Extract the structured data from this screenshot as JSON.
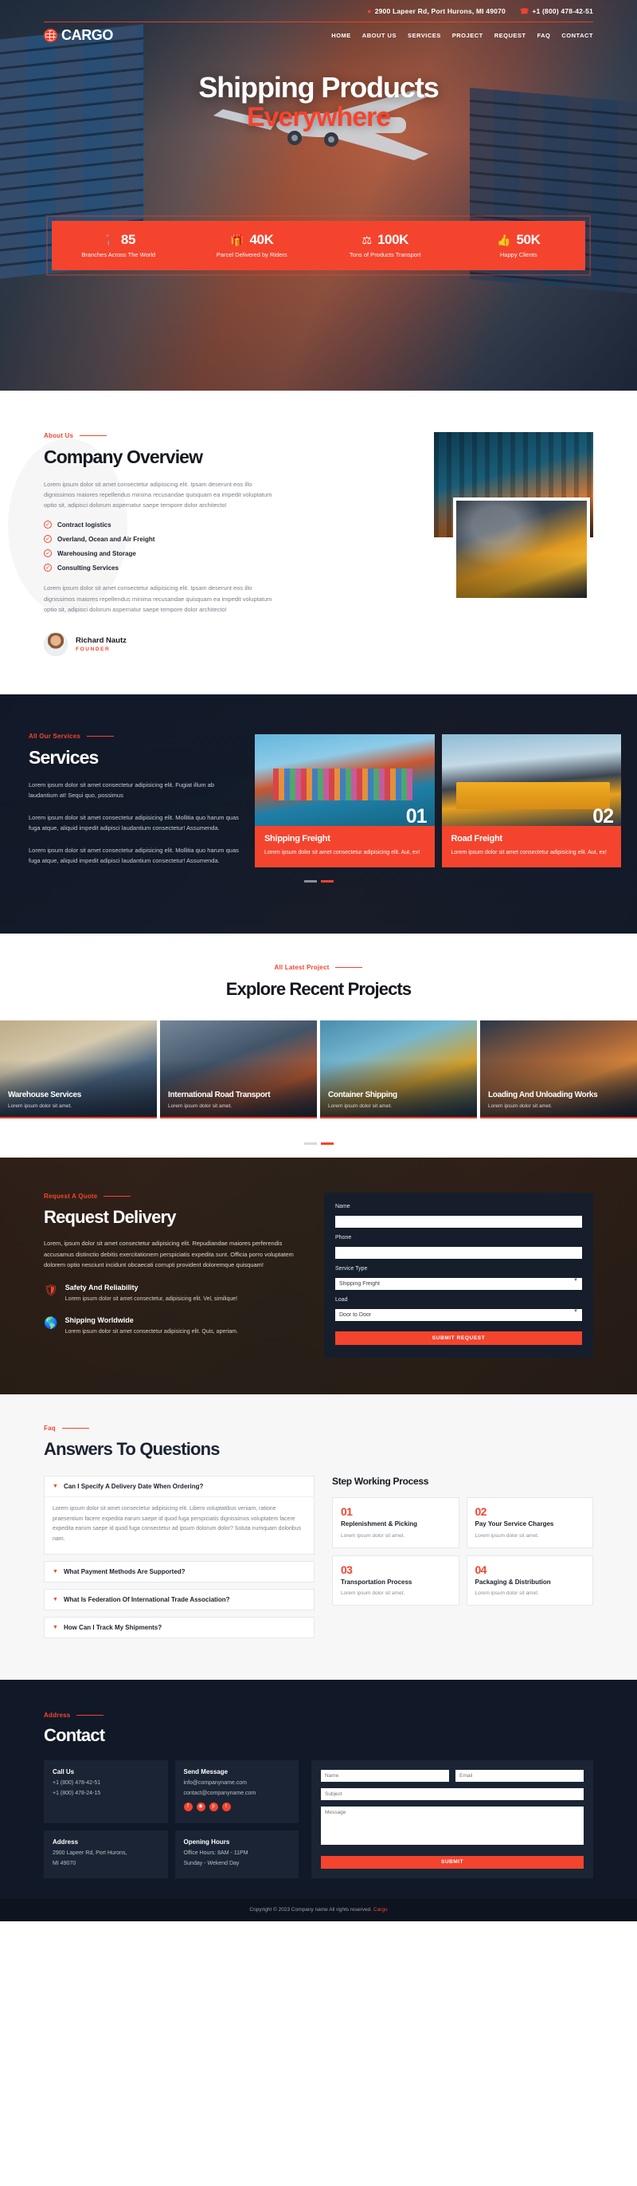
{
  "topbar": {
    "address": "2900 Lapeer Rd, Port Hurons, MI 49070",
    "phone": "+1 (800) 478-42-51",
    "pin_icon": "location-pin-icon",
    "phone_icon": "phone-icon"
  },
  "brand": {
    "name": "CARGO"
  },
  "nav": [
    {
      "label": "HOME"
    },
    {
      "label": "ABOUT US"
    },
    {
      "label": "SERVICES"
    },
    {
      "label": "PROJECT"
    },
    {
      "label": "REQUEST"
    },
    {
      "label": "FAQ"
    },
    {
      "label": "CONTACT"
    }
  ],
  "hero": {
    "title_line1": "Shipping Products",
    "title_line2": "Everywhere"
  },
  "stats": [
    {
      "icon": "location-pin-icon",
      "value": "85",
      "label": "Branches Across The World"
    },
    {
      "icon": "parcel-box-icon",
      "value": "40K",
      "label": "Parcel Delivered by Riders"
    },
    {
      "icon": "weight-icon",
      "value": "100K",
      "label": "Tons of Products Transport"
    },
    {
      "icon": "thumbs-up-icon",
      "value": "50K",
      "label": "Happy Clients"
    }
  ],
  "about": {
    "eyebrow": "About Us",
    "title": "Company Overview",
    "paragraph1": "Lorem ipsum dolor sit amet consectetur adipisicing elit. Ipsam deserunt eos illo dignissimos maiores repellendus minima recusandae quisquam ea impedit voluptatum optio sit, adipisci dolorum aspernatur saepe tempore dolor architecto!",
    "paragraph2": "Lorem ipsum dolor sit amet consectetur adipisicing elit. Ipsam deserunt eos illo dignissimos maiores repellendus minima recusandae quisquam ea impedit voluptatum optio sit, adipisci dolorum aspernatur saepe tempore dolor architecto!",
    "features": [
      {
        "label": "Contract logistics"
      },
      {
        "label": "Overland, Ocean and Air Freight"
      },
      {
        "label": "Warehousing and Storage"
      },
      {
        "label": "Consulting Services"
      }
    ],
    "author_name": "Richard Nautz",
    "author_role": "FOUNDER"
  },
  "services": {
    "eyebrow": "All Our Services",
    "title": "Services",
    "paragraph1": "Lorem ipsum dolor sit amet consectetur adipisicing elit. Fugiat illum ab laudantium at! Sequi quo, possimus",
    "paragraph2": "Lorem ipsum dolor sit amet consectetur adipisicing elit. Mollitia quo harum quas fuga atque, aliquid impedit adipisci laudantium consectetur! Assumenda.",
    "paragraph3": "Lorem ipsum dolor sit amet consectetur adipisicing elit. Mollitia quo harum quas fuga atque, aliquid impedit adipisci laudantium consectetur! Assumenda.",
    "cards": [
      {
        "num": "01",
        "name": "Shipping Freight",
        "desc": "Lorem ipsum dolor sit amet consectetur adipisicing elit. Aut, ex!"
      },
      {
        "num": "02",
        "name": "Road Freight",
        "desc": "Lorem ipsum dolor sit amet consectetur adipisicing elit. Aut, ex!"
      }
    ]
  },
  "projects": {
    "eyebrow": "All Latest Project",
    "title": "Explore Recent Projects",
    "items": [
      {
        "title": "Warehouse Services",
        "sub": "Lorem ipsum dolor sit amet."
      },
      {
        "title": "International Road Transport",
        "sub": "Lorem ipsum dolor sit amet."
      },
      {
        "title": "Container Shipping",
        "sub": "Lorem ipsum dolor sit amet."
      },
      {
        "title": "Loading And Unloading Works",
        "sub": "Lorem ipsum dolor sit amet."
      }
    ]
  },
  "request": {
    "eyebrow": "Request A Quote",
    "title": "Request Delivery",
    "paragraph": "Lorem, ipsum dolor sit amet consectetur adipisicing elit. Repudiandae maiores perferendis accusamus distinctio debitis exercitationem perspiciatis expedita sunt. Officia porro voluptatem dolorem optio nesciunt incidunt obcaecati corrupti provident doloremque quisquam!",
    "features": [
      {
        "icon": "shield-document-icon",
        "title": "Safety And Reliability",
        "desc": "Lorem ipsum dolor sit amet consectetur, adipisicing elit. Vel, similique!"
      },
      {
        "icon": "globe-truck-icon",
        "title": "Shipping Worldwide",
        "desc": "Lorem ipsum dolor sit amet consectetur adipisicing elit. Quis, aperiam."
      }
    ],
    "form": {
      "name_label": "Name",
      "name_value": "",
      "phone_label": "Phone",
      "phone_value": "",
      "service_label": "Service Type",
      "service_value": "Shipping Freight",
      "load_label": "Load",
      "load_value": "Door to Door",
      "submit_label": "SUBMIT REQUEST"
    }
  },
  "faq": {
    "eyebrow": "Faq",
    "title": "Answers To Questions",
    "items": [
      {
        "q": "Can I Specify A Delivery Date When Ordering?",
        "a": "Lorem ipsum dolor sit amet consectetur adipisicing elit. Libero voluptatibus veniam, ratione praesentium facere expedita earum saepe id quod fuga perspiciatis dignissimos voluptatem facere expedita earum saepe id quod fuga consectetur ad ipsum dolorum dolor? Soluta numquam doloribus nam.",
        "open": true
      },
      {
        "q": "What Payment Methods Are Supported?",
        "a": "",
        "open": false
      },
      {
        "q": "What Is Federation Of International Trade Association?",
        "a": "",
        "open": false
      },
      {
        "q": "How Can I Track My Shipments?",
        "a": "",
        "open": false
      }
    ],
    "steps_title": "Step Working Process",
    "steps": [
      {
        "num": "01",
        "name": "Replenishment & Picking",
        "desc": "Lorem ipsum dolor sit amet."
      },
      {
        "num": "02",
        "name": "Pay Your Service Charges",
        "desc": "Lorem ipsum dolor sit amet."
      },
      {
        "num": "03",
        "name": "Transportation Process",
        "desc": "Lorem ipsum dolor sit amet."
      },
      {
        "num": "04",
        "name": "Packaging & Distribution",
        "desc": "Lorem ipsum dolor sit amet."
      }
    ]
  },
  "contact": {
    "eyebrow": "Address",
    "title": "Contact",
    "boxes": [
      {
        "title": "Call Us",
        "line1": "+1 (800) 478-42-51",
        "line2": "+1 (800) 478-24-15"
      },
      {
        "title": "Send Message",
        "line1": "info@companyname.com",
        "line2": "contact@companyname.com"
      },
      {
        "title": "Address",
        "line1": "2900 Lapeer Rd, Port Hurons,",
        "line2": "MI 49070"
      },
      {
        "title": "Opening Hours",
        "line1": "Office Hours: 8AM - 11PM",
        "line2": "Sunday - Wekend Day"
      }
    ],
    "socials": [
      "facebook-icon",
      "instagram-icon",
      "pinterest-icon",
      "twitter-icon"
    ],
    "form": {
      "name_placeholder": "Name",
      "email_placeholder": "Email",
      "subject_placeholder": "Subject",
      "message_placeholder": "Message",
      "submit_label": "SUBMIT"
    }
  },
  "footer": {
    "text": "Copyright © 2023 Company name All rights reserved.",
    "link": "Cargo"
  },
  "colors": {
    "accent": "#f4442e",
    "dark": "#111827",
    "panel": "#1b2434"
  }
}
